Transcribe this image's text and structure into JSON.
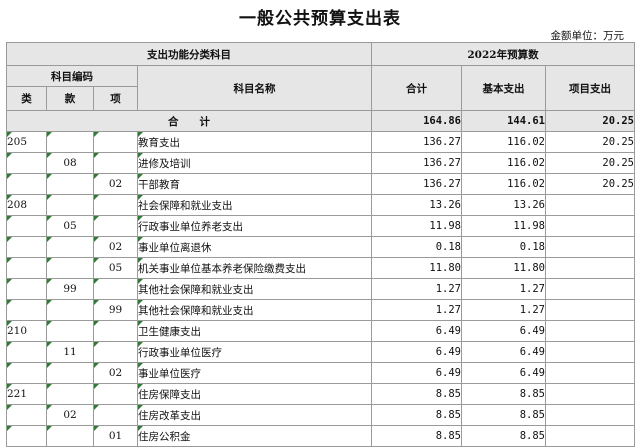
{
  "title": "一般公共预算支出表",
  "unit": "金额单位：万元",
  "headers": {
    "group_left": "支出功能分类科目",
    "group_right": "2022年预算数",
    "code_group": "科目编码",
    "name": "科目名称",
    "lei": "类",
    "kuan": "款",
    "xiang": "项",
    "total_col": "合计",
    "basic_col": "基本支出",
    "project_col": "项目支出"
  },
  "total_row": {
    "label": "合　　计",
    "total": "164.86",
    "basic": "144.61",
    "project": "20.25"
  },
  "rows": [
    {
      "lei": "205",
      "kuan": "",
      "xiang": "",
      "name": "教育支出",
      "total": "136.27",
      "basic": "116.02",
      "project": "20.25"
    },
    {
      "lei": "",
      "kuan": "08",
      "xiang": "",
      "name": "进修及培训",
      "total": "136.27",
      "basic": "116.02",
      "project": "20.25"
    },
    {
      "lei": "",
      "kuan": "",
      "xiang": "02",
      "name": "干部教育",
      "total": "136.27",
      "basic": "116.02",
      "project": "20.25"
    },
    {
      "lei": "208",
      "kuan": "",
      "xiang": "",
      "name": "社会保障和就业支出",
      "total": "13.26",
      "basic": "13.26",
      "project": ""
    },
    {
      "lei": "",
      "kuan": "05",
      "xiang": "",
      "name": "行政事业单位养老支出",
      "total": "11.98",
      "basic": "11.98",
      "project": ""
    },
    {
      "lei": "",
      "kuan": "",
      "xiang": "02",
      "name": "事业单位离退休",
      "total": "0.18",
      "basic": "0.18",
      "project": ""
    },
    {
      "lei": "",
      "kuan": "",
      "xiang": "05",
      "name": "机关事业单位基本养老保险缴费支出",
      "total": "11.80",
      "basic": "11.80",
      "project": ""
    },
    {
      "lei": "",
      "kuan": "99",
      "xiang": "",
      "name": "其他社会保障和就业支出",
      "total": "1.27",
      "basic": "1.27",
      "project": ""
    },
    {
      "lei": "",
      "kuan": "",
      "xiang": "99",
      "name": "其他社会保障和就业支出",
      "total": "1.27",
      "basic": "1.27",
      "project": ""
    },
    {
      "lei": "210",
      "kuan": "",
      "xiang": "",
      "name": "卫生健康支出",
      "total": "6.49",
      "basic": "6.49",
      "project": ""
    },
    {
      "lei": "",
      "kuan": "11",
      "xiang": "",
      "name": "行政事业单位医疗",
      "total": "6.49",
      "basic": "6.49",
      "project": ""
    },
    {
      "lei": "",
      "kuan": "",
      "xiang": "02",
      "name": "事业单位医疗",
      "total": "6.49",
      "basic": "6.49",
      "project": ""
    },
    {
      "lei": "221",
      "kuan": "",
      "xiang": "",
      "name": "住房保障支出",
      "total": "8.85",
      "basic": "8.85",
      "project": ""
    },
    {
      "lei": "",
      "kuan": "02",
      "xiang": "",
      "name": "住房改革支出",
      "total": "8.85",
      "basic": "8.85",
      "project": ""
    },
    {
      "lei": "",
      "kuan": "",
      "xiang": "01",
      "name": "住房公积金",
      "total": "8.85",
      "basic": "8.85",
      "project": ""
    }
  ]
}
